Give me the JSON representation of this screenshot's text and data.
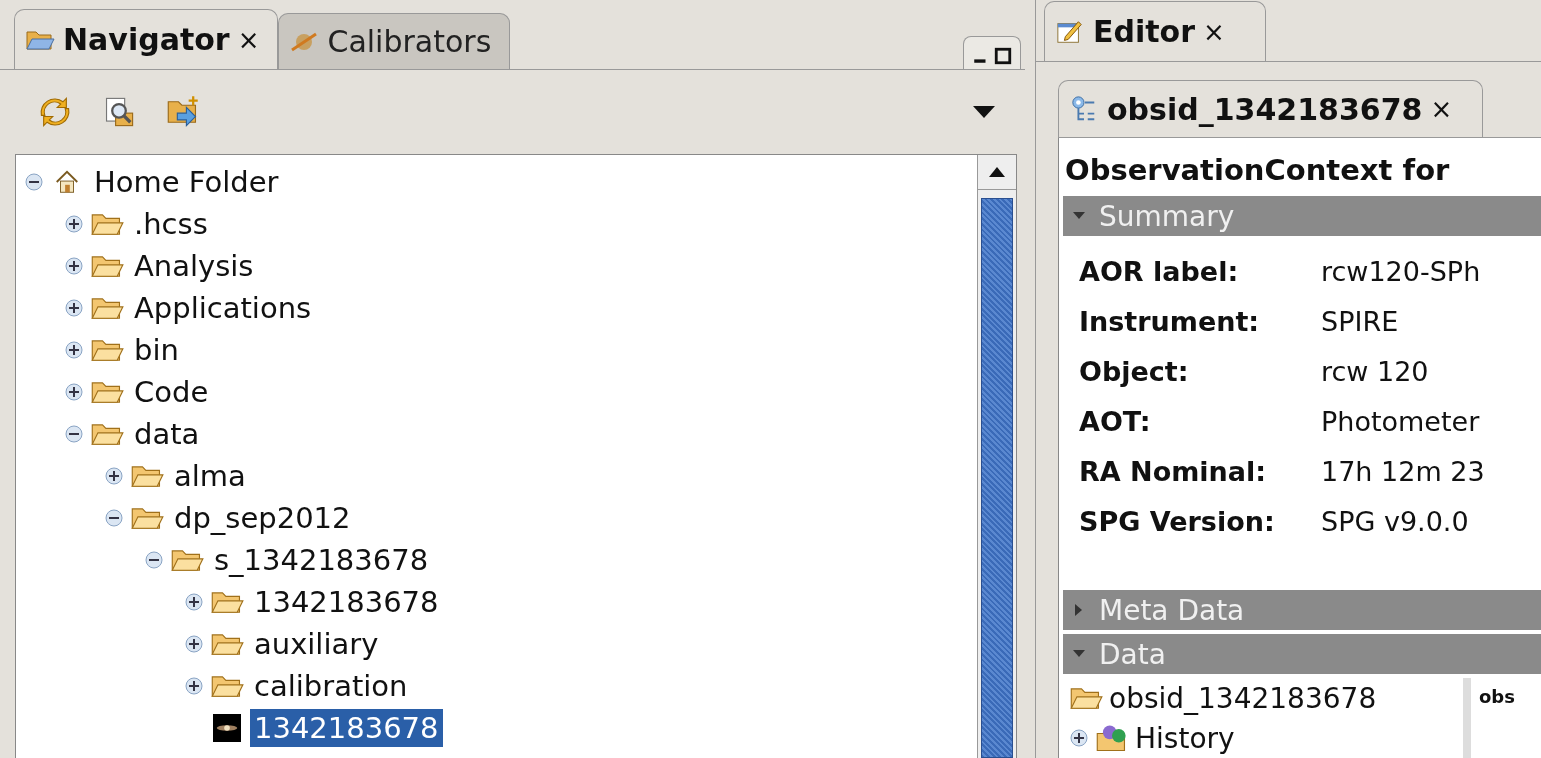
{
  "navigator": {
    "tabs": [
      {
        "label": "Navigator",
        "close": "×",
        "selected": true,
        "kind": "navigator"
      },
      {
        "label": "Calibrators",
        "selected": false,
        "kind": "calibrators"
      }
    ],
    "tree": [
      {
        "label": "Home Folder",
        "kind": "home",
        "expanded": true,
        "selected": false,
        "children": [
          {
            "label": ".hcss",
            "kind": "folder",
            "expanded": false,
            "selected": false
          },
          {
            "label": "Analysis",
            "kind": "folder",
            "expanded": false,
            "selected": false
          },
          {
            "label": "Applications",
            "kind": "folder",
            "expanded": false,
            "selected": false
          },
          {
            "label": "bin",
            "kind": "folder",
            "expanded": false,
            "selected": false
          },
          {
            "label": "Code",
            "kind": "folder",
            "expanded": false,
            "selected": false
          },
          {
            "label": "data",
            "kind": "folder",
            "expanded": true,
            "selected": false,
            "children": [
              {
                "label": "alma",
                "kind": "folder",
                "expanded": false,
                "selected": false
              },
              {
                "label": "dp_sep2012",
                "kind": "folder",
                "expanded": true,
                "selected": false,
                "children": [
                  {
                    "label": "s_1342183678",
                    "kind": "folder",
                    "expanded": true,
                    "selected": false,
                    "children": [
                      {
                        "label": "1342183678",
                        "kind": "folder",
                        "expanded": false,
                        "selected": false
                      },
                      {
                        "label": "auxiliary",
                        "kind": "folder",
                        "expanded": false,
                        "selected": false
                      },
                      {
                        "label": "calibration",
                        "kind": "folder",
                        "expanded": false,
                        "selected": false
                      },
                      {
                        "label": "1342183678",
                        "kind": "image",
                        "selected": true
                      }
                    ]
                  }
                ]
              }
            ]
          }
        ]
      }
    ]
  },
  "editor": {
    "tab": {
      "label": "Editor",
      "close": "×"
    },
    "document_tab": {
      "label": "obsid_1342183678",
      "close": "×"
    },
    "title": "ObservationContext for",
    "sections": [
      {
        "title": "Summary",
        "expanded": true,
        "fields": [
          {
            "label": "AOR label:",
            "value": "rcw120-SPh"
          },
          {
            "label": "Instrument:",
            "value": "SPIRE"
          },
          {
            "label": "Object:",
            "value": "rcw 120"
          },
          {
            "label": "AOT:",
            "value": "Photometer"
          },
          {
            "label": "RA Nominal:",
            "value": "17h 12m 23"
          },
          {
            "label": "SPG Version:",
            "value": "SPG v9.0.0"
          }
        ]
      },
      {
        "title": "Meta Data",
        "expanded": false
      },
      {
        "title": "Data",
        "expanded": true,
        "tree": [
          {
            "label": "obsid_1342183678",
            "kind": "folder"
          },
          {
            "label": "History",
            "kind": "history",
            "expanded": false
          }
        ],
        "column_2": "obs"
      }
    ]
  }
}
